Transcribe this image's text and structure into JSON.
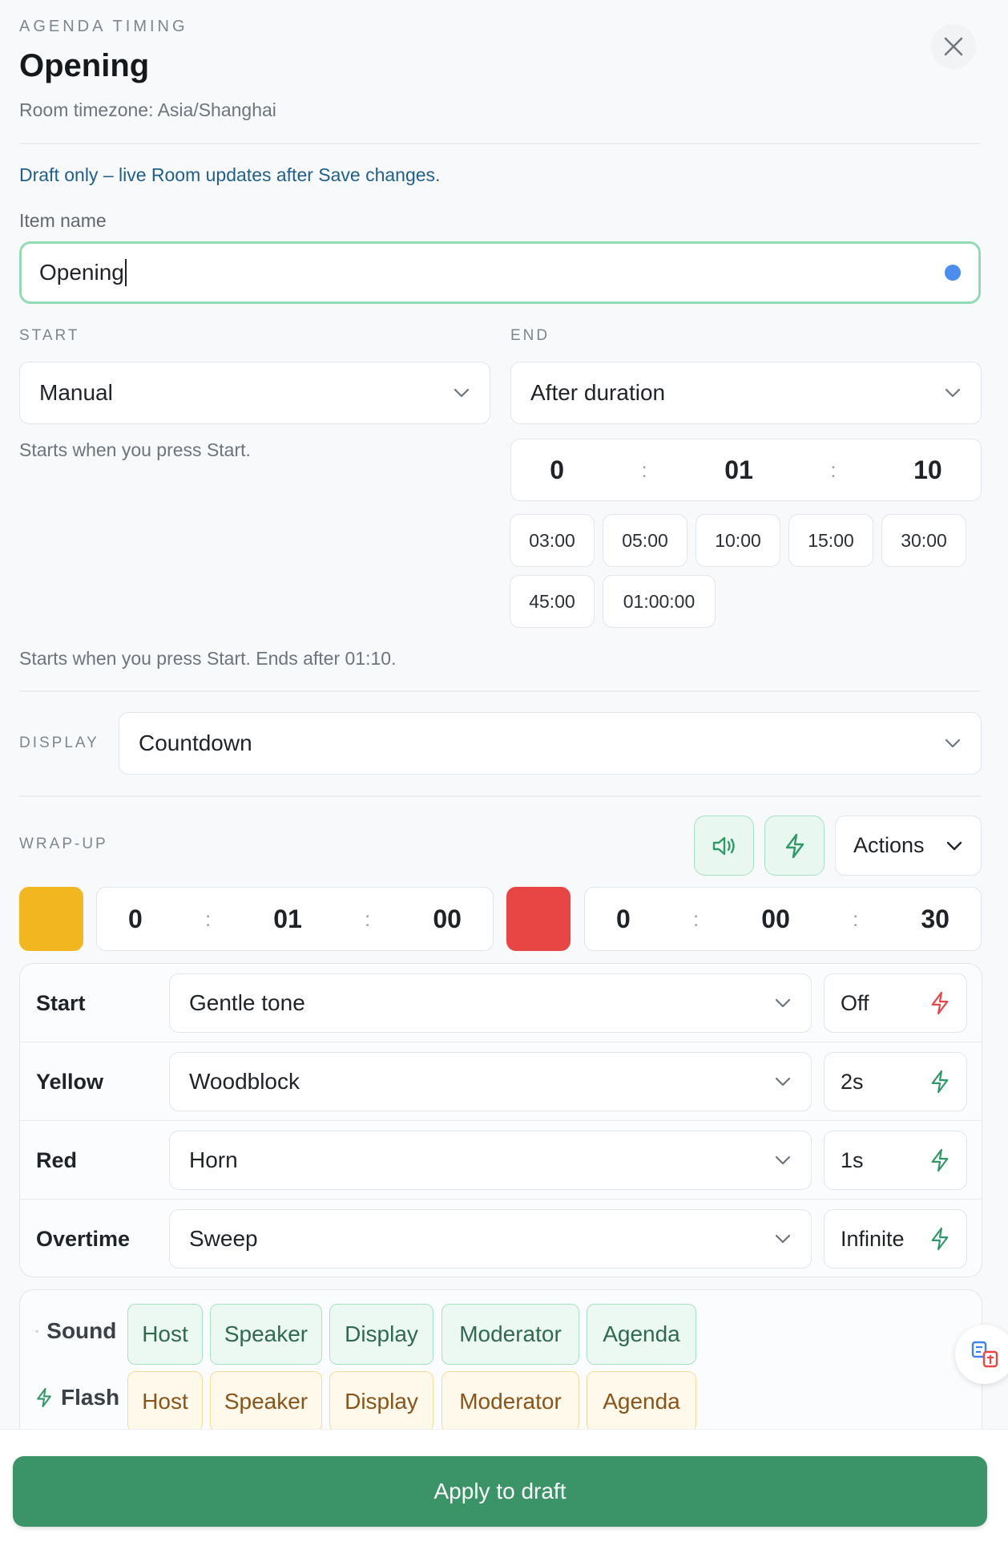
{
  "header": {
    "kicker": "AGENDA TIMING",
    "title": "Opening",
    "timezone": "Room timezone: Asia/Shanghai"
  },
  "notice": "Draft only – live Room updates after Save changes.",
  "item_name": {
    "label": "Item name",
    "value": "Opening"
  },
  "start": {
    "label": "START",
    "value": "Manual",
    "hint": "Starts when you press Start."
  },
  "end": {
    "label": "END",
    "value": "After duration",
    "duration": {
      "h": "0",
      "m": "01",
      "s": "10"
    },
    "presets": [
      "03:00",
      "05:00",
      "10:00",
      "15:00",
      "30:00",
      "45:00",
      "01:00:00"
    ]
  },
  "summary": "Starts when you press Start. Ends after 01:10.",
  "display": {
    "label": "DISPLAY",
    "value": "Countdown"
  },
  "wrapup": {
    "label": "WRAP-UP",
    "actions_label": "Actions",
    "yellow": {
      "color": "#f2b720",
      "h": "0",
      "m": "01",
      "s": "00"
    },
    "red": {
      "color": "#e84545",
      "h": "0",
      "m": "00",
      "s": "30"
    }
  },
  "cues": [
    {
      "label": "Start",
      "sound": "Gentle tone",
      "duration": "Off",
      "flash_color": "#e84545"
    },
    {
      "label": "Yellow",
      "sound": "Woodblock",
      "duration": "2s",
      "flash_color": "#2f9a68"
    },
    {
      "label": "Red",
      "sound": "Horn",
      "duration": "1s",
      "flash_color": "#2f9a68"
    },
    {
      "label": "Overtime",
      "sound": "Sweep",
      "duration": "Infinite",
      "flash_color": "#2f9a68"
    }
  ],
  "targets": {
    "sound_label": "Sound",
    "flash_label": "Flash",
    "sound": [
      "Host",
      "Speaker",
      "Display",
      "Moderator",
      "Agenda"
    ],
    "flash": [
      "Host",
      "Speaker",
      "Display",
      "Moderator",
      "Agenda"
    ]
  },
  "apply_label": "Apply to draft",
  "colors": {
    "accent": "#3a9467",
    "focus": "#8fdcb5",
    "notice": "#1f5f8a"
  }
}
